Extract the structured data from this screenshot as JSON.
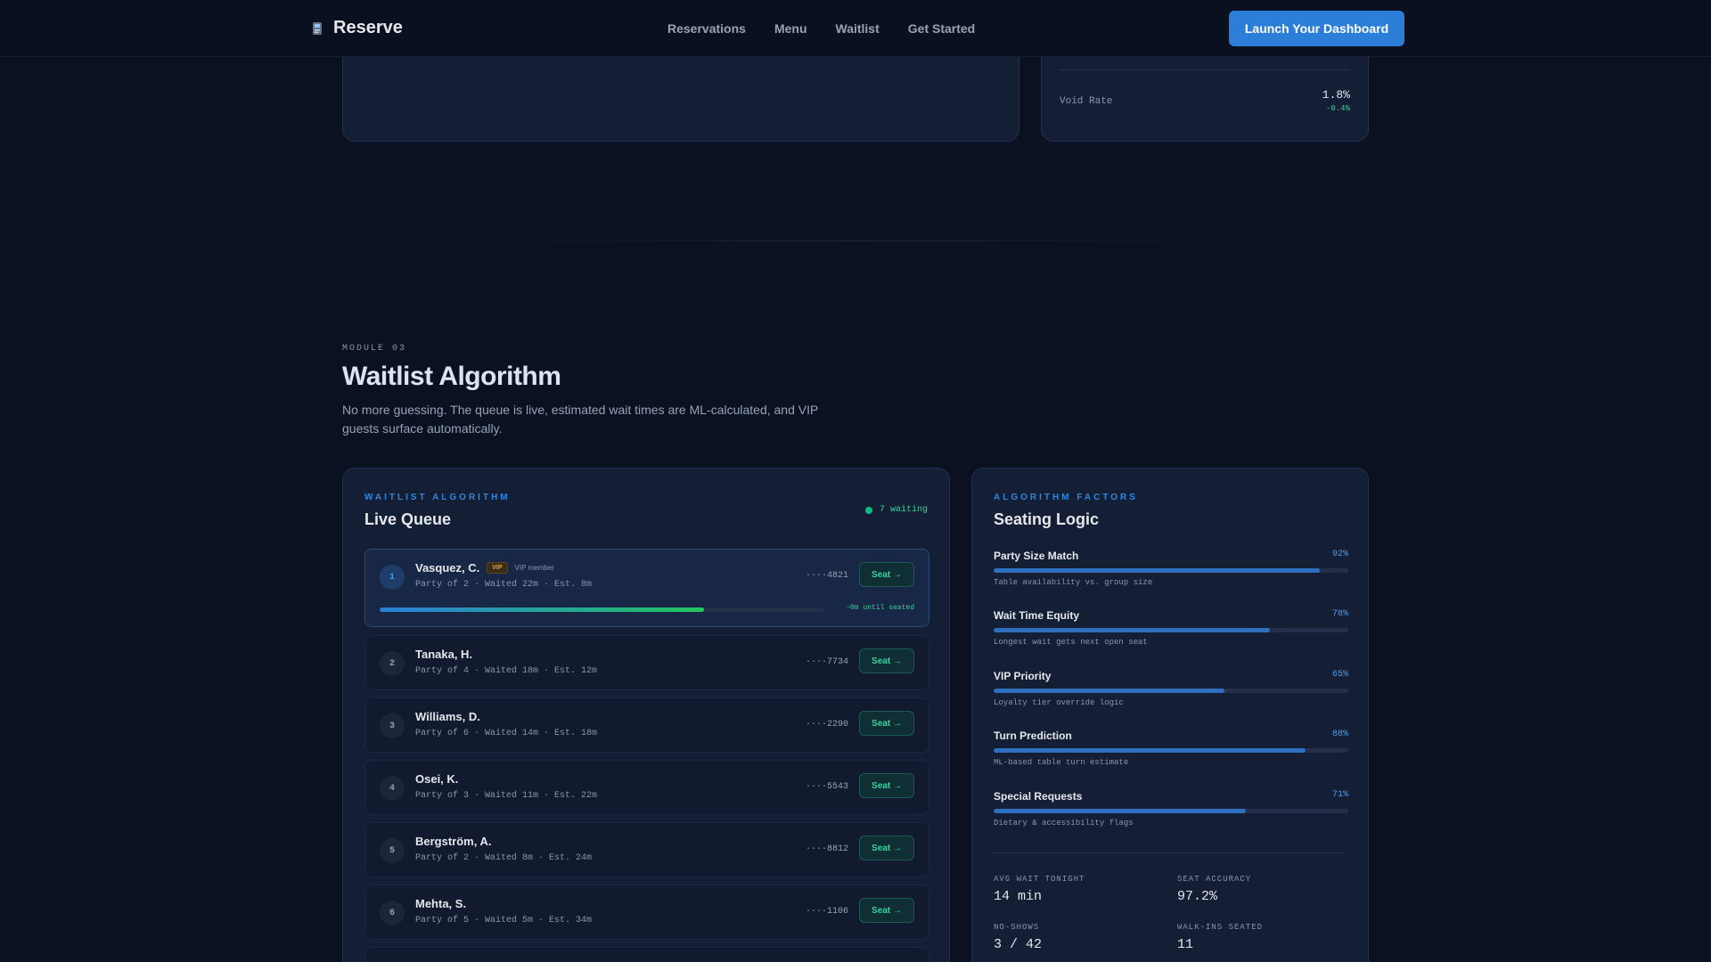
{
  "nav": {
    "brand": "Reserve",
    "links": [
      "Reservations",
      "Menu",
      "Waitlist",
      "Get Started"
    ],
    "cta": "Launch Your Dashboard"
  },
  "upper": {
    "metric_label": "Void Rate",
    "metric_value": "1.8%",
    "metric_delta": "-0.4%"
  },
  "section": {
    "module": "MODULE 03",
    "title": "Waitlist Algorithm",
    "description": "No more guessing. The queue is live, estimated wait times are ML-calculated, and VIP guests surface automatically."
  },
  "queue": {
    "eyebrow": "WAITLIST ALGORITHM",
    "title": "Live Queue",
    "waiting": "7 waiting",
    "seat_label": "Seat →",
    "rows": [
      {
        "num": "1",
        "name": "Vasquez, C.",
        "vip": "VIP",
        "vip_note": "VIP member",
        "meta": "Party of 2 · Waited 22m · Est. 8m",
        "phone": "····4821",
        "progress": 0.73,
        "progress_note": "~0m until seated"
      },
      {
        "num": "2",
        "name": "Tanaka, H.",
        "meta": "Party of 4 · Waited 18m · Est. 12m",
        "phone": "····7734"
      },
      {
        "num": "3",
        "name": "Williams, D.",
        "meta": "Party of 6 · Waited 14m · Est. 18m",
        "phone": "····2290"
      },
      {
        "num": "4",
        "name": "Osei, K.",
        "meta": "Party of 3 · Waited 11m · Est. 22m",
        "phone": "····5543"
      },
      {
        "num": "5",
        "name": "Bergström, A.",
        "meta": "Party of 2 · Waited 8m · Est. 24m",
        "phone": "····8812"
      },
      {
        "num": "6",
        "name": "Mehta, S.",
        "meta": "Party of 5 · Waited 5m · Est. 34m",
        "phone": "····1106"
      }
    ]
  },
  "logic": {
    "eyebrow": "ALGORITHM FACTORS",
    "title": "Seating Logic",
    "factors": [
      {
        "name": "Party Size Match",
        "pct": "92%",
        "value": 0.92,
        "desc": "Table availability vs. group size"
      },
      {
        "name": "Wait Time Equity",
        "pct": "78%",
        "value": 0.78,
        "desc": "Longest wait gets next open seat"
      },
      {
        "name": "VIP Priority",
        "pct": "65%",
        "value": 0.65,
        "desc": "Loyalty tier override logic"
      },
      {
        "name": "Turn Prediction",
        "pct": "88%",
        "value": 0.88,
        "desc": "ML-based table turn estimate"
      },
      {
        "name": "Special Requests",
        "pct": "71%",
        "value": 0.71,
        "desc": "Dietary & accessibility flags"
      }
    ],
    "stats": [
      {
        "label": "AVG WAIT TONIGHT",
        "value": "14 min"
      },
      {
        "label": "SEAT ACCURACY",
        "value": "97.2%"
      },
      {
        "label": "NO-SHOWS",
        "value": "3 / 42"
      },
      {
        "label": "WALK-INS SEATED",
        "value": "11"
      }
    ]
  }
}
